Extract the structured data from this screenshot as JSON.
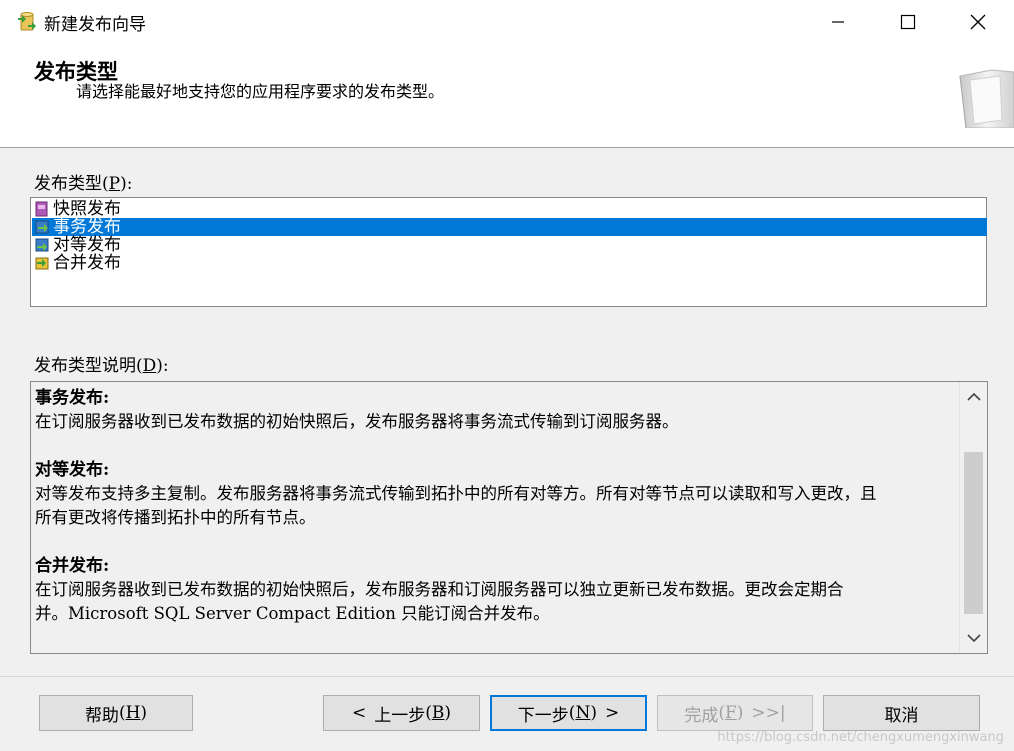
{
  "window": {
    "title": "新建发布向导",
    "app_icon": "publication-wizard-icon",
    "controls": [
      "minimize-icon",
      "maximize-icon",
      "close-icon"
    ]
  },
  "header": {
    "title": "发布类型",
    "subtitle": "请选择能最好地支持您的应用程序要求的发布类型。",
    "graphic": "book-graphic-icon"
  },
  "publication_type": {
    "label": "发布类型",
    "hotkey": "P",
    "items": [
      {
        "label": "快照发布",
        "icon": "snapshot-publication-icon",
        "selected": false
      },
      {
        "label": "事务发布",
        "icon": "transactional-publication-icon",
        "selected": true
      },
      {
        "label": "对等发布",
        "icon": "peer-to-peer-publication-icon",
        "selected": false
      },
      {
        "label": "合并发布",
        "icon": "merge-publication-icon",
        "selected": false
      }
    ]
  },
  "description": {
    "label": "发布类型说明",
    "hotkey": "D",
    "sections": [
      {
        "title": "事务发布:",
        "lines": [
          "在订阅服务器收到已发布数据的初始快照后，发布服务器将事务流式传输到订阅服务器。"
        ]
      },
      {
        "title": "对等发布:",
        "lines": [
          "对等发布支持多主复制。发布服务器将事务流式传输到拓扑中的所有对等方。所有对等节点可以读取和写入更改，且",
          "所有更改将传播到拓扑中的所有节点。"
        ]
      },
      {
        "title": "合并发布:",
        "lines": [
          "在订阅服务器收到已发布数据的初始快照后，发布服务器和订阅服务器可以独立更新已发布数据。更改会定期合",
          "并。Microsoft SQL Server Compact Edition 只能订阅合并发布。"
        ]
      }
    ]
  },
  "footer": {
    "help": {
      "text": "帮助",
      "hotkey": "H"
    },
    "back": {
      "prefix": "<",
      "text": "上一步",
      "hotkey": "B"
    },
    "next": {
      "text": "下一步",
      "hotkey": "N",
      "suffix": ">"
    },
    "finish": {
      "text": "完成",
      "hotkey": "F",
      "suffix": ">>|"
    },
    "cancel": {
      "text": "取消"
    },
    "watermark": "https://blog.csdn.net/chengxumengxinwang"
  },
  "colors": {
    "selection": "#0078d7",
    "focus_border": "#0078d7"
  }
}
